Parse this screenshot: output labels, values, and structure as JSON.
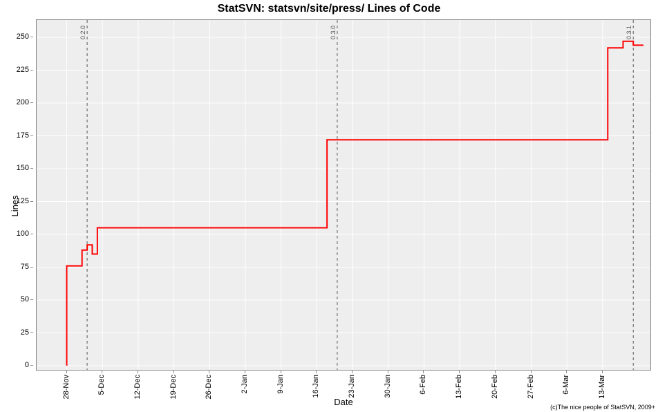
{
  "chart_data": {
    "type": "line",
    "title": "StatSVN: statsvn/site/press/ Lines of Code",
    "xlabel": "Date",
    "ylabel": "Lines",
    "ylim": [
      0,
      260
    ],
    "y_ticks": [
      0,
      25,
      50,
      75,
      100,
      125,
      150,
      175,
      200,
      225,
      250
    ],
    "x_ticks": [
      "28-Nov",
      "5-Dec",
      "12-Dec",
      "19-Dec",
      "26-Dec",
      "2-Jan",
      "9-Jan",
      "16-Jan",
      "23-Jan",
      "30-Jan",
      "6-Feb",
      "13-Feb",
      "20-Feb",
      "27-Feb",
      "6-Mar",
      "13-Mar"
    ],
    "x_range_days": 113,
    "x_start_offset_days": 4,
    "series": [
      {
        "name": "Lines of Code",
        "color": "#ff0000",
        "points": [
          {
            "x": 0,
            "y": 0
          },
          {
            "x": 0,
            "y": 76
          },
          {
            "x": 3,
            "y": 76
          },
          {
            "x": 3,
            "y": 88
          },
          {
            "x": 4,
            "y": 88
          },
          {
            "x": 4,
            "y": 92
          },
          {
            "x": 5,
            "y": 92
          },
          {
            "x": 5,
            "y": 85
          },
          {
            "x": 6,
            "y": 85
          },
          {
            "x": 6,
            "y": 105
          },
          {
            "x": 51,
            "y": 105
          },
          {
            "x": 51,
            "y": 172
          },
          {
            "x": 106,
            "y": 172
          },
          {
            "x": 106,
            "y": 242
          },
          {
            "x": 109,
            "y": 242
          },
          {
            "x": 109,
            "y": 247
          },
          {
            "x": 111,
            "y": 247
          },
          {
            "x": 111,
            "y": 244
          },
          {
            "x": 113,
            "y": 244
          }
        ]
      }
    ],
    "markers": [
      {
        "x": 4,
        "label": "0.2.0"
      },
      {
        "x": 53,
        "label": "0.3.0"
      },
      {
        "x": 111,
        "label": "0.3.1"
      }
    ],
    "credit": "(c)The nice people of StatSVN, 2009+"
  }
}
